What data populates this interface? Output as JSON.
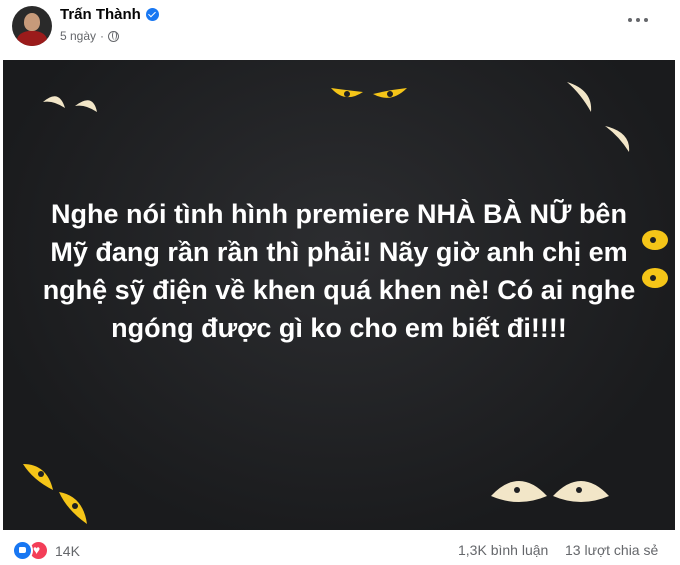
{
  "author": {
    "name": "Trấn Thành",
    "verified": true
  },
  "post_meta": {
    "time": "5 ngày",
    "separator": "·",
    "audience_icon": "globe-icon"
  },
  "post": {
    "text": "Nghe nói tình hình premiere NHÀ BÀ NỮ bên Mỹ đang rần rần thì phải! Nãy giờ anh chị em nghệ sỹ điện về khen quá khen nè! Có ai nghe ngóng được gì ko cho em biết đi!!!!",
    "background_color": "#1f2022",
    "text_color": "#ffffff",
    "eye_colors": {
      "cream": "#f2e6c8",
      "yellow": "#f5c518"
    }
  },
  "footer": {
    "reaction_icons": [
      "like-icon",
      "love-icon"
    ],
    "reaction_count": "14K",
    "comments": "1,3K bình luận",
    "shares": "13 lượt chia sẻ"
  },
  "colors": {
    "accent": "#1877f2",
    "love": "#f33e58",
    "muted": "#65676b"
  }
}
